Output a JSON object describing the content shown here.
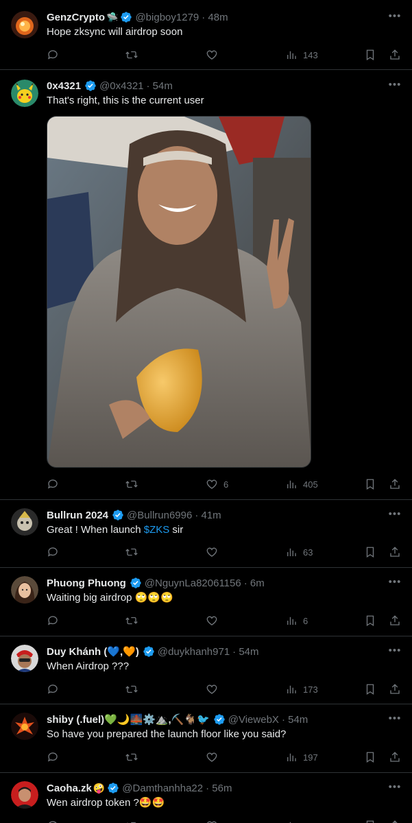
{
  "colors": {
    "background": "#000000",
    "text": "#e7e9ea",
    "muted": "#71767b",
    "accent": "#1d9bf0",
    "divider": "#2f3336"
  },
  "tweets": [
    {
      "name": "GenzCrypto",
      "name_emoji": "🛸",
      "handle": "@bigboy1279",
      "time": "· 48m",
      "text": "Hope zksync will airdrop soon",
      "reply_count": "",
      "retweet_count": "",
      "like_count": "",
      "view_count": "143"
    },
    {
      "name": "0x4321",
      "name_emoji": "",
      "handle": "@0x4321",
      "time": "· 54m",
      "text": "That's right, this is the current user",
      "reply_count": "",
      "retweet_count": "",
      "like_count": "6",
      "view_count": "405",
      "has_media": true
    },
    {
      "name": "Bullrun 2024",
      "name_emoji": "",
      "handle": "@Bullrun6996",
      "time": "· 41m",
      "text_before": "Great ! When launch ",
      "text_link": "$ZKS",
      "text_after": " sir",
      "reply_count": "",
      "retweet_count": "",
      "like_count": "",
      "view_count": "63"
    },
    {
      "name": "Phuong Phuong",
      "name_emoji": "",
      "handle": "@NguynLa82061156",
      "time": "· 6m",
      "text": "Waiting big airdrop 🙄🙄🙄",
      "reply_count": "",
      "retweet_count": "",
      "like_count": "",
      "view_count": "6"
    },
    {
      "name": "Duy Khánh (💙,🧡)",
      "name_emoji": "",
      "handle": "@duykhanh971",
      "time": "· 54m",
      "text": "When Airdrop ???",
      "reply_count": "",
      "retweet_count": "",
      "like_count": "",
      "view_count": "173"
    },
    {
      "name": "shiby (.fuel)💚🌙🌉⚙️⛰️,⛏️🐐🐦",
      "name_emoji": "",
      "handle": "@ViewebX",
      "time": "· 54m",
      "text": "So have you prepared the launch floor like you said?",
      "reply_count": "",
      "retweet_count": "",
      "like_count": "",
      "view_count": "197"
    },
    {
      "name": "Caoha.zk",
      "name_emoji": "🤪",
      "handle": "@Damthanhha22",
      "time": "· 56m",
      "text": "Wen airdrop token  ?🤩🤩",
      "reply_count": "",
      "retweet_count": "",
      "like_count": "",
      "view_count": ""
    }
  ]
}
